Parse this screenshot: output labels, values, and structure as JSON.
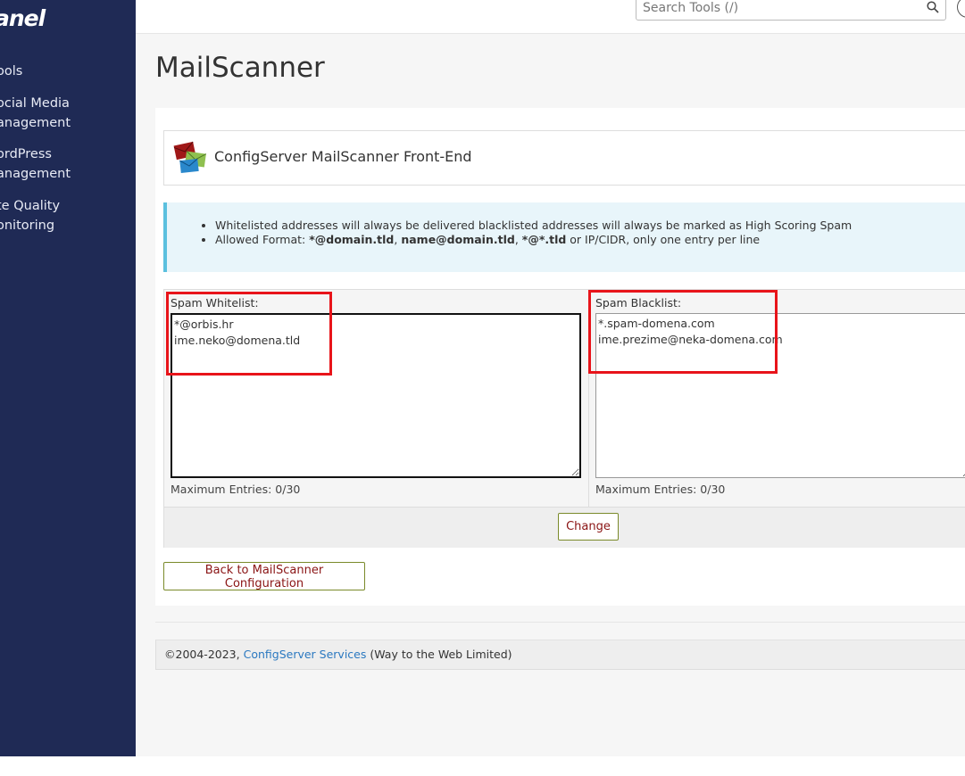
{
  "sidebar": {
    "logo": "anel",
    "items": [
      {
        "line1": "ools",
        "line2": ""
      },
      {
        "line1": "ocial Media",
        "line2": "anagement"
      },
      {
        "line1": "ordPress",
        "line2": "anagement"
      },
      {
        "line1": "te Quality",
        "line2": "onitoring"
      }
    ]
  },
  "header": {
    "search_placeholder": "Search Tools (/)"
  },
  "page": {
    "title": "MailScanner",
    "app_name": "ConfigServer MailScanner Front-End"
  },
  "info": {
    "line1": "Whitelisted addresses will always be delivered blacklisted addresses will always be marked as High Scoring Spam",
    "line2_prefix": "Allowed Format: ",
    "fmt1": "*@domain.tld",
    "sep1": ", ",
    "fmt2": "name@domain.tld",
    "sep2": ", ",
    "fmt3": "*@*.tld",
    "line2_suffix": " or IP/CIDR, only one entry per line"
  },
  "whitelist": {
    "label": "Spam Whitelist:",
    "value": "*@orbis.hr\nime.neko@domena.tld",
    "max_entries": "Maximum Entries: 0/30"
  },
  "blacklist": {
    "label": "Spam Blacklist:",
    "value": "*.spam-domena.com\nime.prezime@neka-domena.com",
    "max_entries": "Maximum Entries: 0/30"
  },
  "buttons": {
    "change": "Change",
    "back": "Back to MailScanner Configuration"
  },
  "footer": {
    "prefix": "©2004-2023, ",
    "link": "ConfigServer Services",
    "suffix": " (Way to the Web Limited)"
  }
}
